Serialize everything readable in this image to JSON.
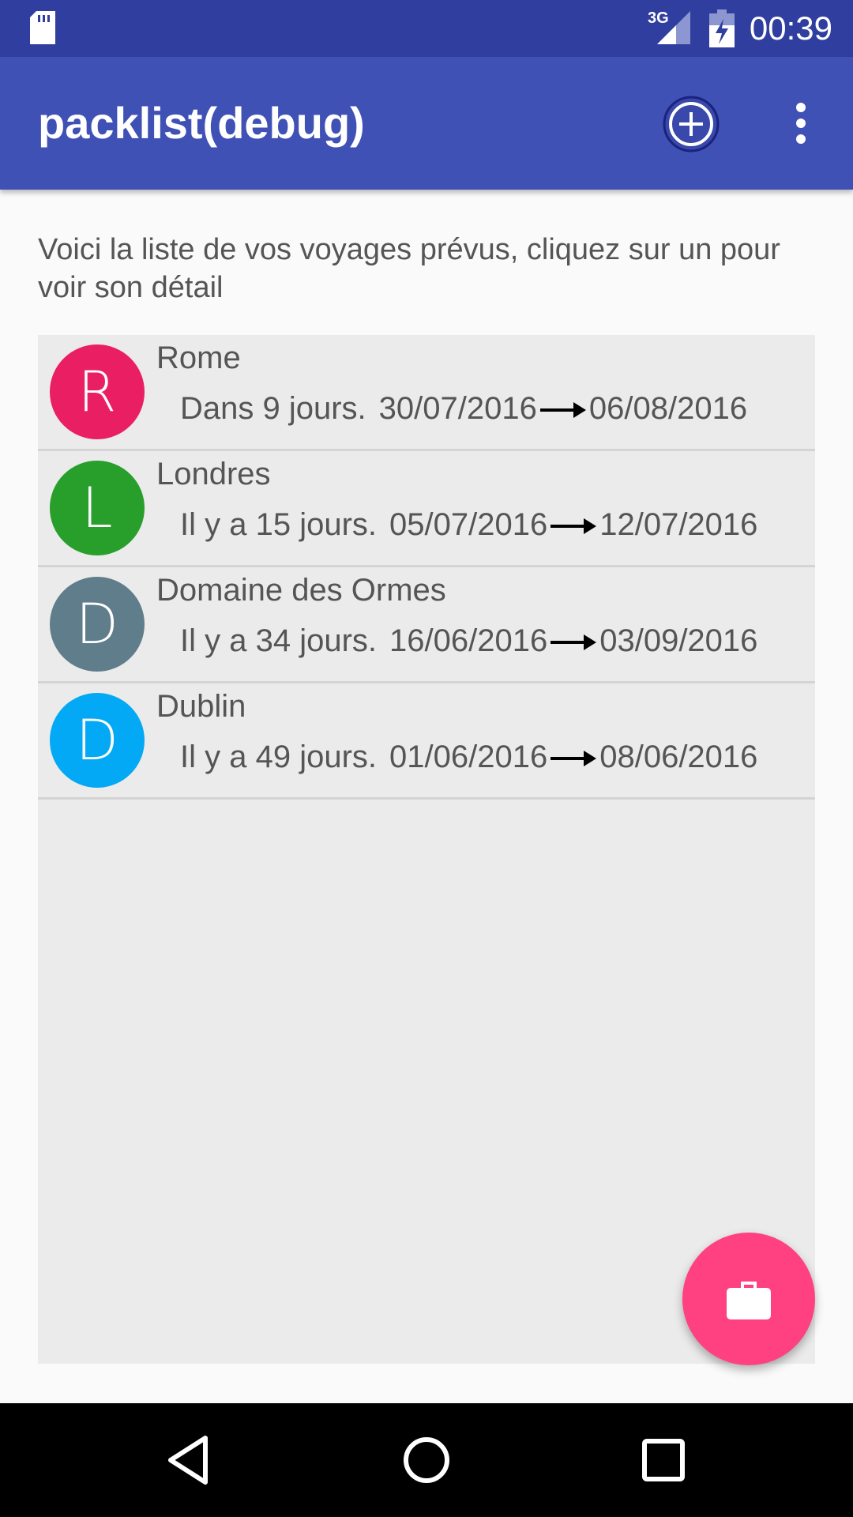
{
  "status_bar": {
    "network_label": "3G",
    "time": "00:39",
    "icons": [
      "sd-card-icon",
      "signal-icon",
      "battery-icon"
    ]
  },
  "app_bar": {
    "title": "packlist(debug)",
    "actions": [
      "add-circle-icon",
      "more-vert-icon"
    ]
  },
  "intro_text": "Voici la liste de vos voyages prévus, cliquez sur un pour voir son détail",
  "trips": [
    {
      "initial": "R",
      "name": "Rome",
      "relative": "Dans 9 jours.",
      "start": "30/07/2016",
      "end": "06/08/2016",
      "color": "#e91e63"
    },
    {
      "initial": "L",
      "name": "Londres",
      "relative": "Il y a 15 jours.",
      "start": "05/07/2016",
      "end": "12/07/2016",
      "color": "#279f2a"
    },
    {
      "initial": "D",
      "name": "Domaine des Ormes",
      "relative": "Il y a 34 jours.",
      "start": "16/06/2016",
      "end": "03/09/2016",
      "color": "#607d8b"
    },
    {
      "initial": "D",
      "name": "Dublin",
      "relative": "Il y a 49 jours.",
      "start": "01/06/2016",
      "end": "08/06/2016",
      "color": "#03a9f4"
    }
  ],
  "fab": {
    "icon": "briefcase-icon",
    "color": "#ff4081"
  },
  "colors": {
    "status_bar": "#303f9f",
    "app_bar": "#3f51b5",
    "list_bg": "#ebebeb"
  },
  "nav_bar": {
    "icons": [
      "back-icon",
      "home-icon",
      "recents-icon"
    ]
  }
}
